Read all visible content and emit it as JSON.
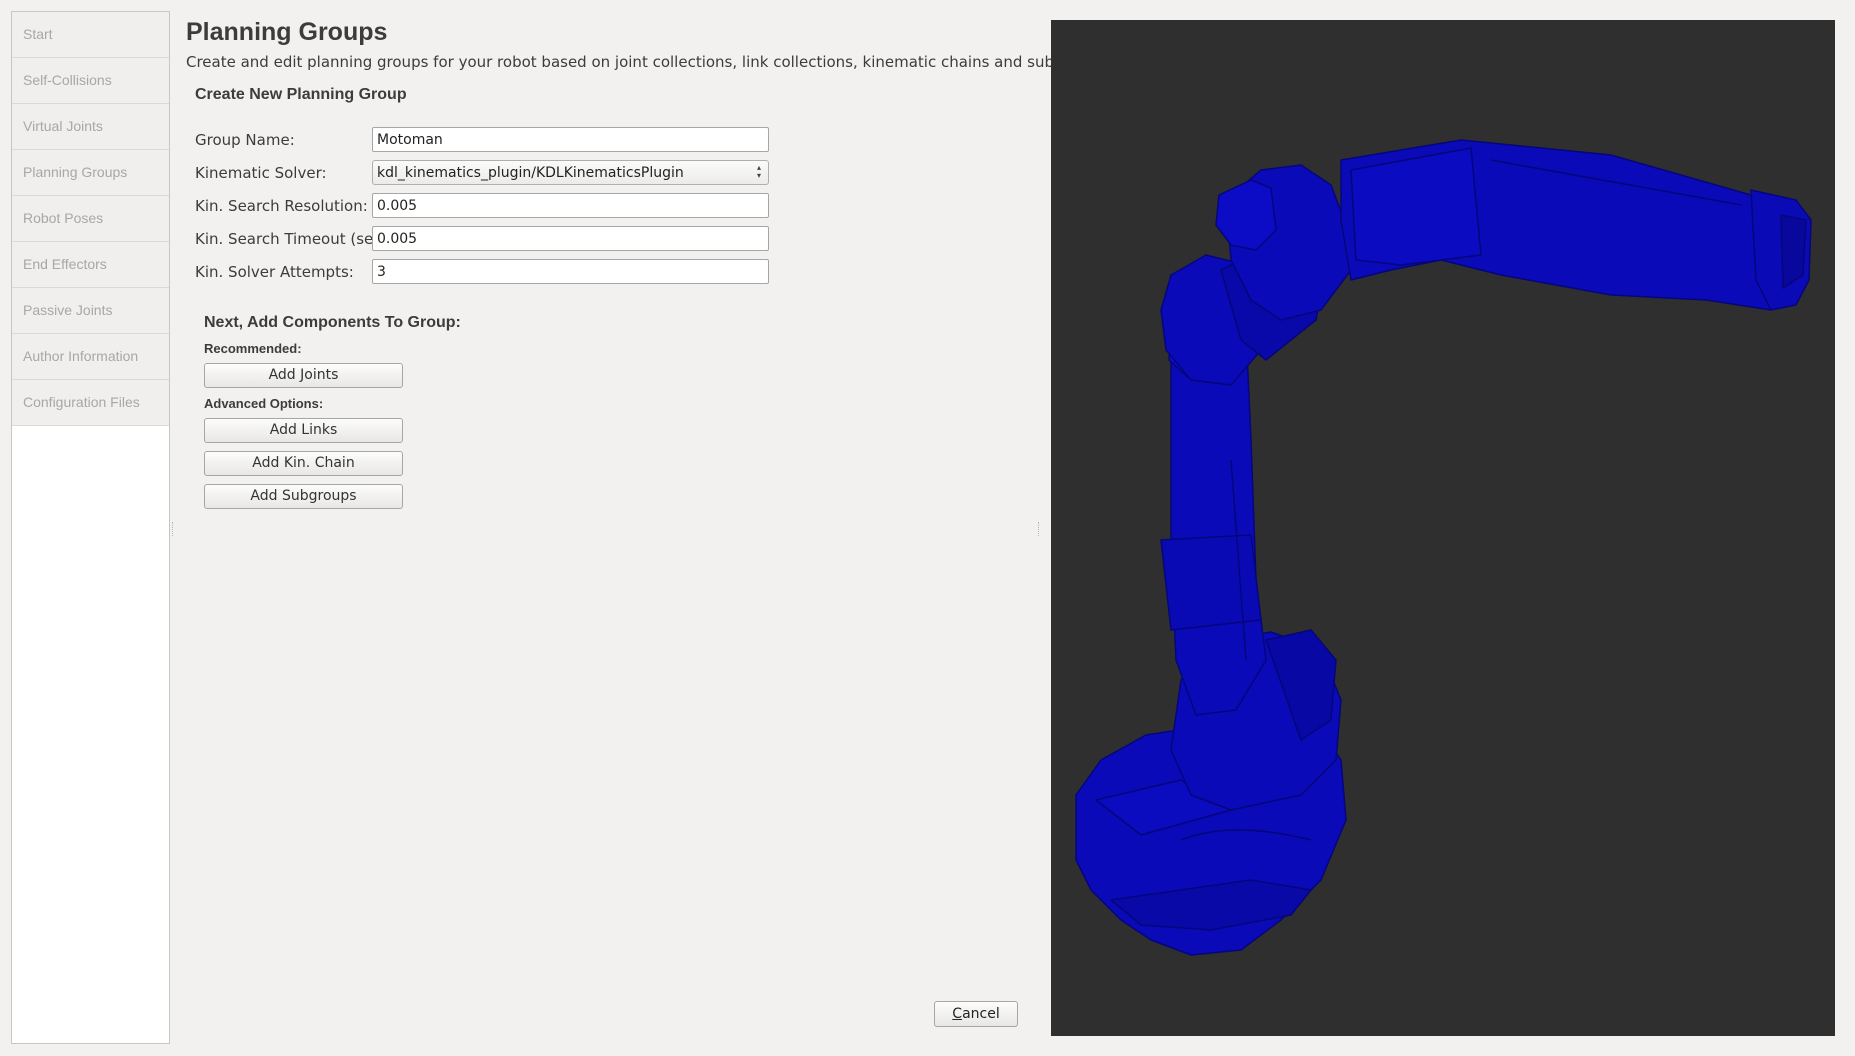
{
  "sidebar": {
    "items": [
      {
        "label": "Start"
      },
      {
        "label": "Self-Collisions"
      },
      {
        "label": "Virtual Joints"
      },
      {
        "label": "Planning Groups"
      },
      {
        "label": "Robot Poses"
      },
      {
        "label": "End Effectors"
      },
      {
        "label": "Passive Joints"
      },
      {
        "label": "Author Information"
      },
      {
        "label": "Configuration Files"
      }
    ]
  },
  "main": {
    "title": "Planning Groups",
    "description": "Create and edit planning groups for your robot based on joint collections, link collections, kinematic chains and subgroups.",
    "section_title": "Create New Planning Group",
    "form": {
      "group_name": {
        "label": "Group Name:",
        "value": "Motoman"
      },
      "kinematic_solver": {
        "label": "Kinematic Solver:",
        "value": "kdl_kinematics_plugin/KDLKinematicsPlugin"
      },
      "search_resolution": {
        "label": "Kin. Search Resolution:",
        "value": "0.005"
      },
      "search_timeout": {
        "label": "Kin. Search Timeout (sec):",
        "value": "0.005"
      },
      "solver_attempts": {
        "label": "Kin. Solver Attempts:",
        "value": "3"
      }
    },
    "components": {
      "title": "Next, Add Components To Group:",
      "recommended_label": "Recommended:",
      "advanced_label": "Advanced Options:",
      "add_joints": "Add Joints",
      "add_links": "Add Links",
      "add_kin_chain": "Add Kin. Chain",
      "add_subgroups": "Add Subgroups"
    },
    "cancel_mnemonic": "C",
    "cancel_rest": "ancel"
  },
  "viewport": {
    "background": "#2f2f2f",
    "robot_color": "#0a0ab8"
  }
}
